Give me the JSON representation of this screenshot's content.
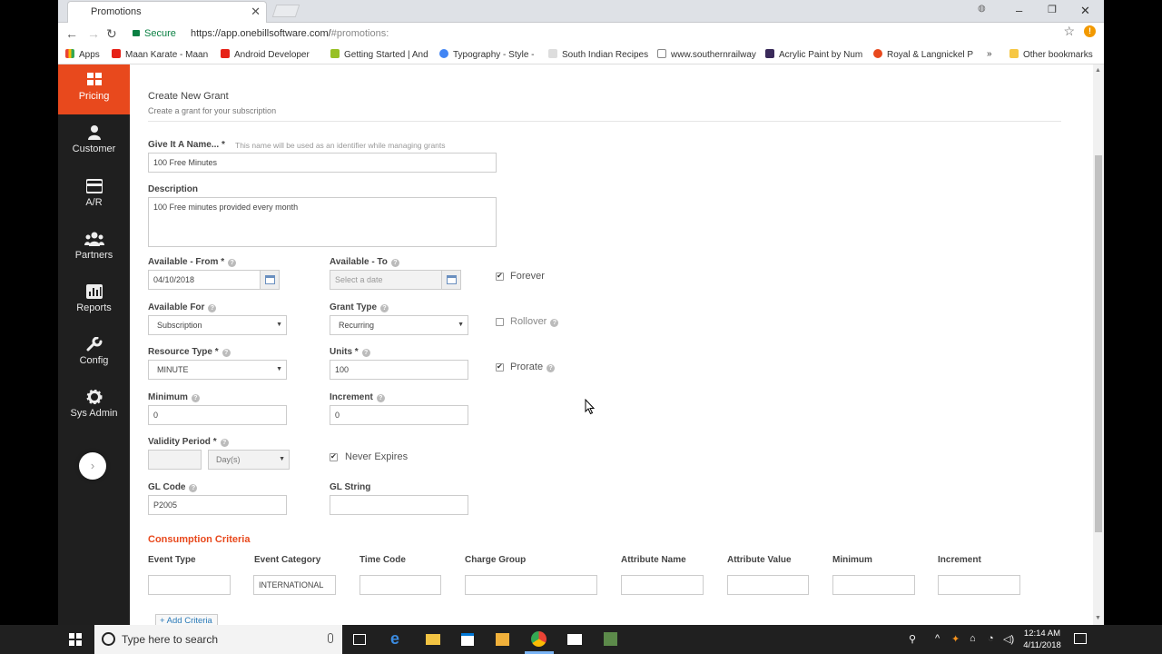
{
  "browser": {
    "tab_title": "Promotions",
    "secure_label": "Secure",
    "url_main": "https://app.onebillsoftware.com/",
    "url_hash": "#promotions:",
    "bookmarks": [
      "Apps",
      "Maan Karate - Maan",
      "Android Developer",
      "Getting Started | And",
      "Typography - Style -",
      "South Indian Recipes",
      "www.southernrailway",
      "Acrylic Paint by Num",
      "Royal & Langnickel P"
    ],
    "other_bookmarks": "Other bookmarks",
    "more": "»"
  },
  "sidebar": {
    "items": [
      {
        "label": "Pricing",
        "icon": "grid-icon"
      },
      {
        "label": "Customer",
        "icon": "user-icon"
      },
      {
        "label": "A/R",
        "icon": "card-icon"
      },
      {
        "label": "Partners",
        "icon": "group-icon"
      },
      {
        "label": "Reports",
        "icon": "chart-icon"
      },
      {
        "label": "Config",
        "icon": "wrench-icon"
      },
      {
        "label": "Sys Admin",
        "icon": "gear-icon"
      }
    ],
    "expand": "›"
  },
  "form": {
    "title": "Create New Grant",
    "subtitle": "Create a grant for your subscription",
    "name_label": "Give It A Name... *",
    "name_hint": "This name will be used as an identifier while managing grants",
    "name_value": "100 Free Minutes",
    "desc_label": "Description",
    "desc_value": "100 Free minutes provided every month",
    "from_label": "Available - From *",
    "from_value": "04/10/2018",
    "to_label": "Available - To",
    "to_placeholder": "Select a date",
    "forever_label": "Forever",
    "avail_for_label": "Available For",
    "avail_for_value": "Subscription",
    "grant_type_label": "Grant Type",
    "grant_type_value": "Recurring",
    "rollover_label": "Rollover",
    "resource_label": "Resource Type *",
    "resource_value": "MINUTE",
    "units_label": "Units *",
    "units_value": "100",
    "prorate_label": "Prorate",
    "min_label": "Minimum",
    "min_value": "0",
    "inc_label": "Increment",
    "inc_value": "0",
    "validity_label": "Validity Period *",
    "validity_unit": "Day(s)",
    "never_expires_label": "Never Expires",
    "gl_code_label": "GL Code",
    "gl_code_value": "P2005",
    "gl_string_label": "GL String",
    "help": "?"
  },
  "criteria": {
    "title": "Consumption Criteria",
    "columns": [
      "Event Type",
      "Event Category",
      "Time Code",
      "Charge Group",
      "Attribute Name",
      "Attribute Value",
      "Minimum",
      "Increment"
    ],
    "values": [
      "",
      "INTERNATIONAL",
      "",
      "",
      "",
      "",
      "",
      ""
    ],
    "add_label": "+ Add Criteria"
  },
  "taskbar": {
    "search_placeholder": "Type here to search",
    "time": "12:14 AM",
    "date": "4/11/2018"
  },
  "colors": {
    "accent": "#e8491d",
    "sidebar": "#1f1f1f",
    "link": "#2a7ab8"
  }
}
